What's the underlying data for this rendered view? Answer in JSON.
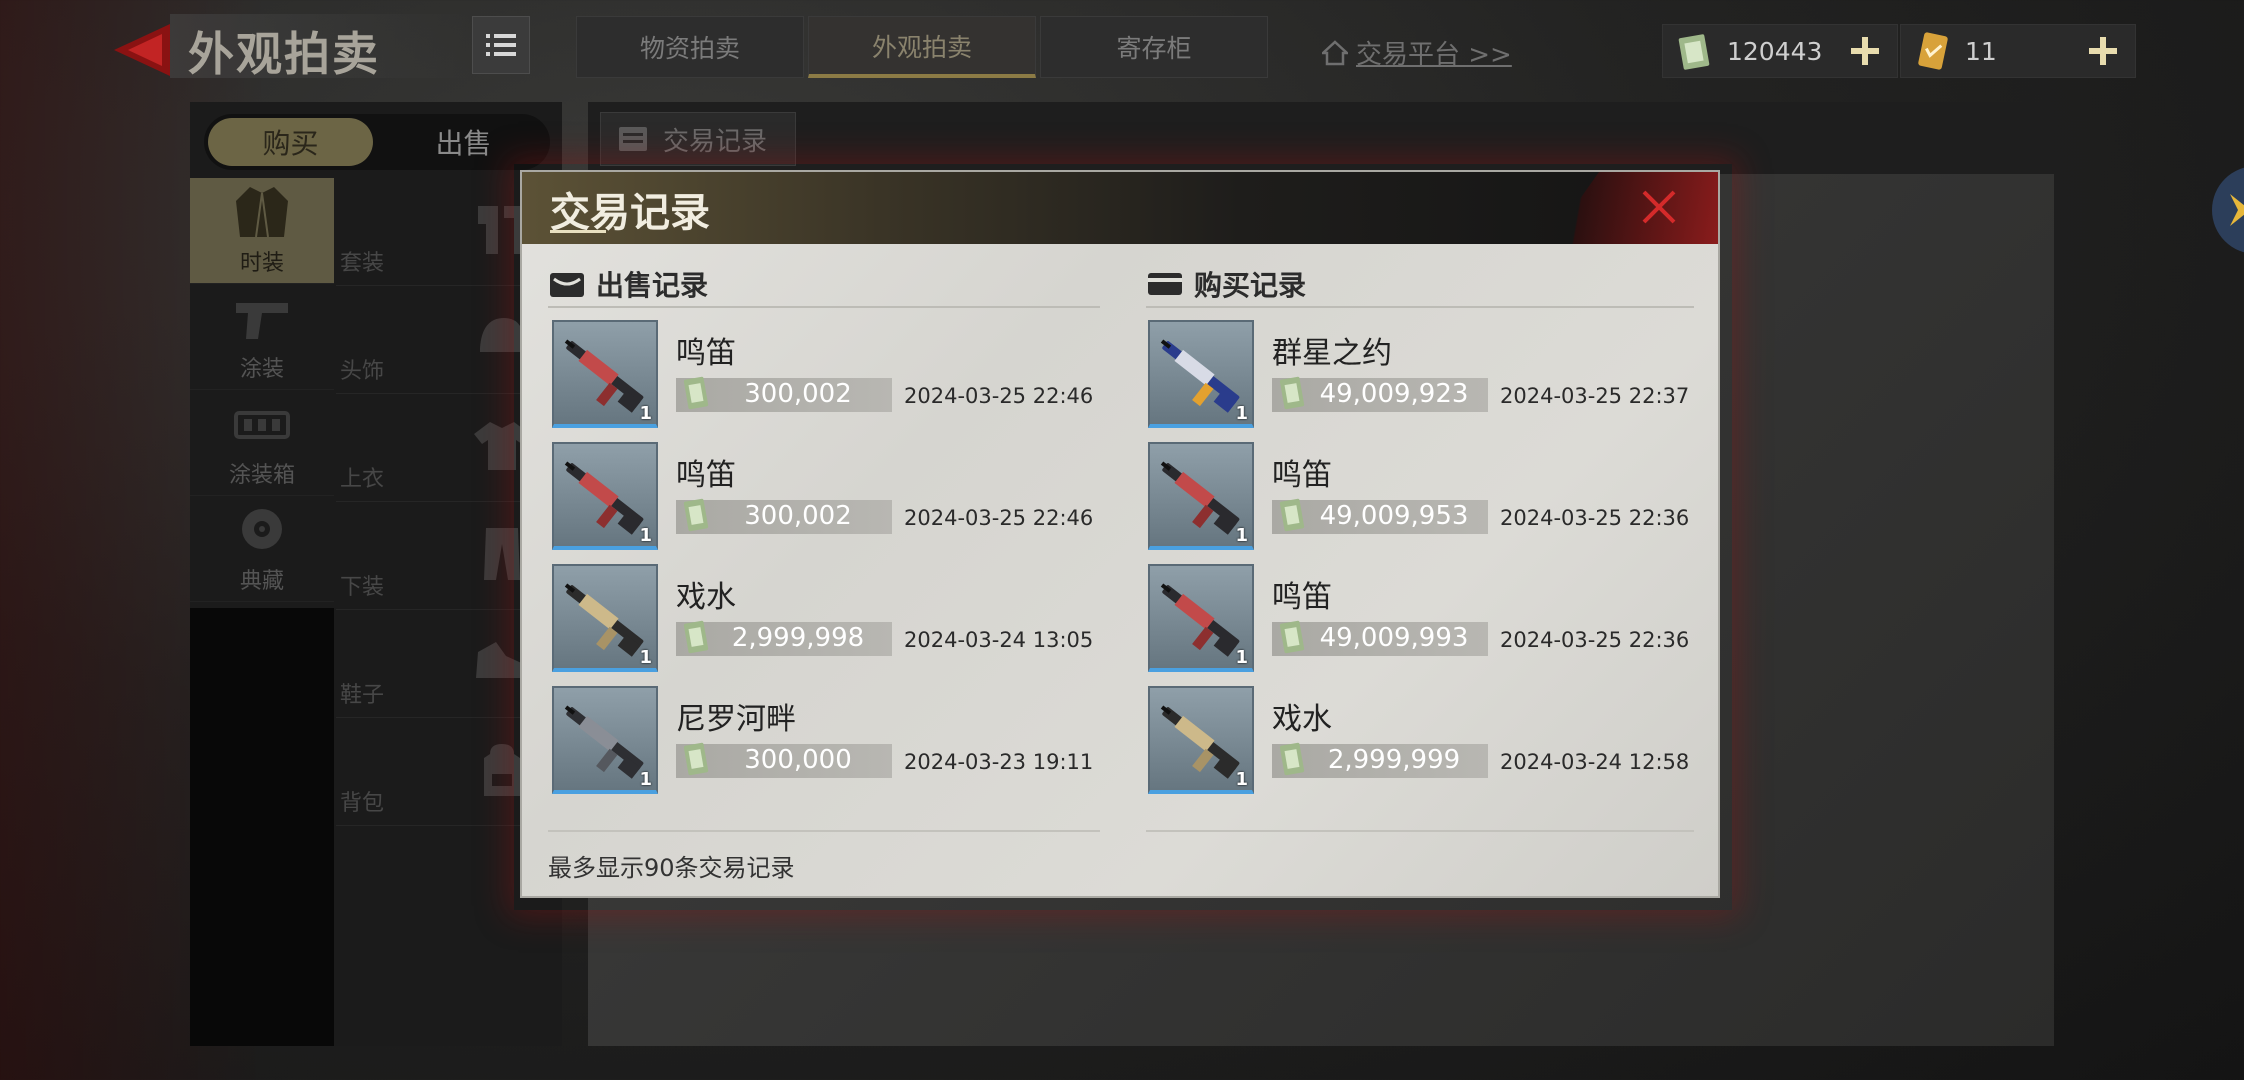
{
  "header": {
    "title": "外观拍卖",
    "tabs": [
      {
        "label": "物资拍卖",
        "active": false
      },
      {
        "label": "外观拍卖",
        "active": true
      },
      {
        "label": "寄存柜",
        "active": false
      }
    ],
    "trade_link": "交易平台 >>"
  },
  "currencies": [
    {
      "icon": "cash-icon",
      "amount": "120443"
    },
    {
      "icon": "ticket-icon",
      "amount": "11"
    }
  ],
  "sidebar": {
    "buy_label": "购买",
    "sell_label": "出售",
    "categories": [
      {
        "label": "时装",
        "icon": "coat-icon",
        "active": true
      },
      {
        "label": "涂装",
        "icon": "pistol-icon",
        "active": false
      },
      {
        "label": "涂装箱",
        "icon": "paint-box-icon",
        "active": false
      },
      {
        "label": "典藏",
        "icon": "collection-icon",
        "active": false
      }
    ],
    "subcategories": [
      {
        "label": "套装",
        "icon": "suit-icon"
      },
      {
        "label": "头饰",
        "icon": "cap-icon"
      },
      {
        "label": "上衣",
        "icon": "shirt-icon"
      },
      {
        "label": "下装",
        "icon": "pants-icon"
      },
      {
        "label": "鞋子",
        "icon": "shoe-icon"
      },
      {
        "label": "背包",
        "icon": "backpack-icon"
      }
    ]
  },
  "record_tab": "交易记录",
  "modal": {
    "title": "交易记录",
    "sell_section": "出售记录",
    "buy_section": "购买记录",
    "footnote": "最多显示90条交易记录",
    "sell_records": [
      {
        "name": "鸣笛",
        "price": "300,002",
        "date": "2024-03-25 22:46",
        "qty": "1",
        "skin": "red"
      },
      {
        "name": "鸣笛",
        "price": "300,002",
        "date": "2024-03-25 22:46",
        "qty": "1",
        "skin": "red"
      },
      {
        "name": "戏水",
        "price": "2,999,998",
        "date": "2024-03-24 13:05",
        "qty": "1",
        "skin": "tan"
      },
      {
        "name": "尼罗河畔",
        "price": "300,000",
        "date": "2024-03-23 19:11",
        "qty": "1",
        "skin": "grey"
      }
    ],
    "buy_records": [
      {
        "name": "群星之约",
        "price": "49,009,923",
        "date": "2024-03-25 22:37",
        "qty": "1",
        "skin": "blue"
      },
      {
        "name": "鸣笛",
        "price": "49,009,953",
        "date": "2024-03-25 22:36",
        "qty": "1",
        "skin": "red"
      },
      {
        "name": "鸣笛",
        "price": "49,009,993",
        "date": "2024-03-25 22:36",
        "qty": "1",
        "skin": "red"
      },
      {
        "name": "戏水",
        "price": "2,999,999",
        "date": "2024-03-24 12:58",
        "qty": "1",
        "skin": "tan"
      }
    ]
  },
  "colors": {
    "accent_gold": "#8c7b45",
    "close_red": "#d42a2a",
    "rarity_blue": "#4aa0e0"
  }
}
